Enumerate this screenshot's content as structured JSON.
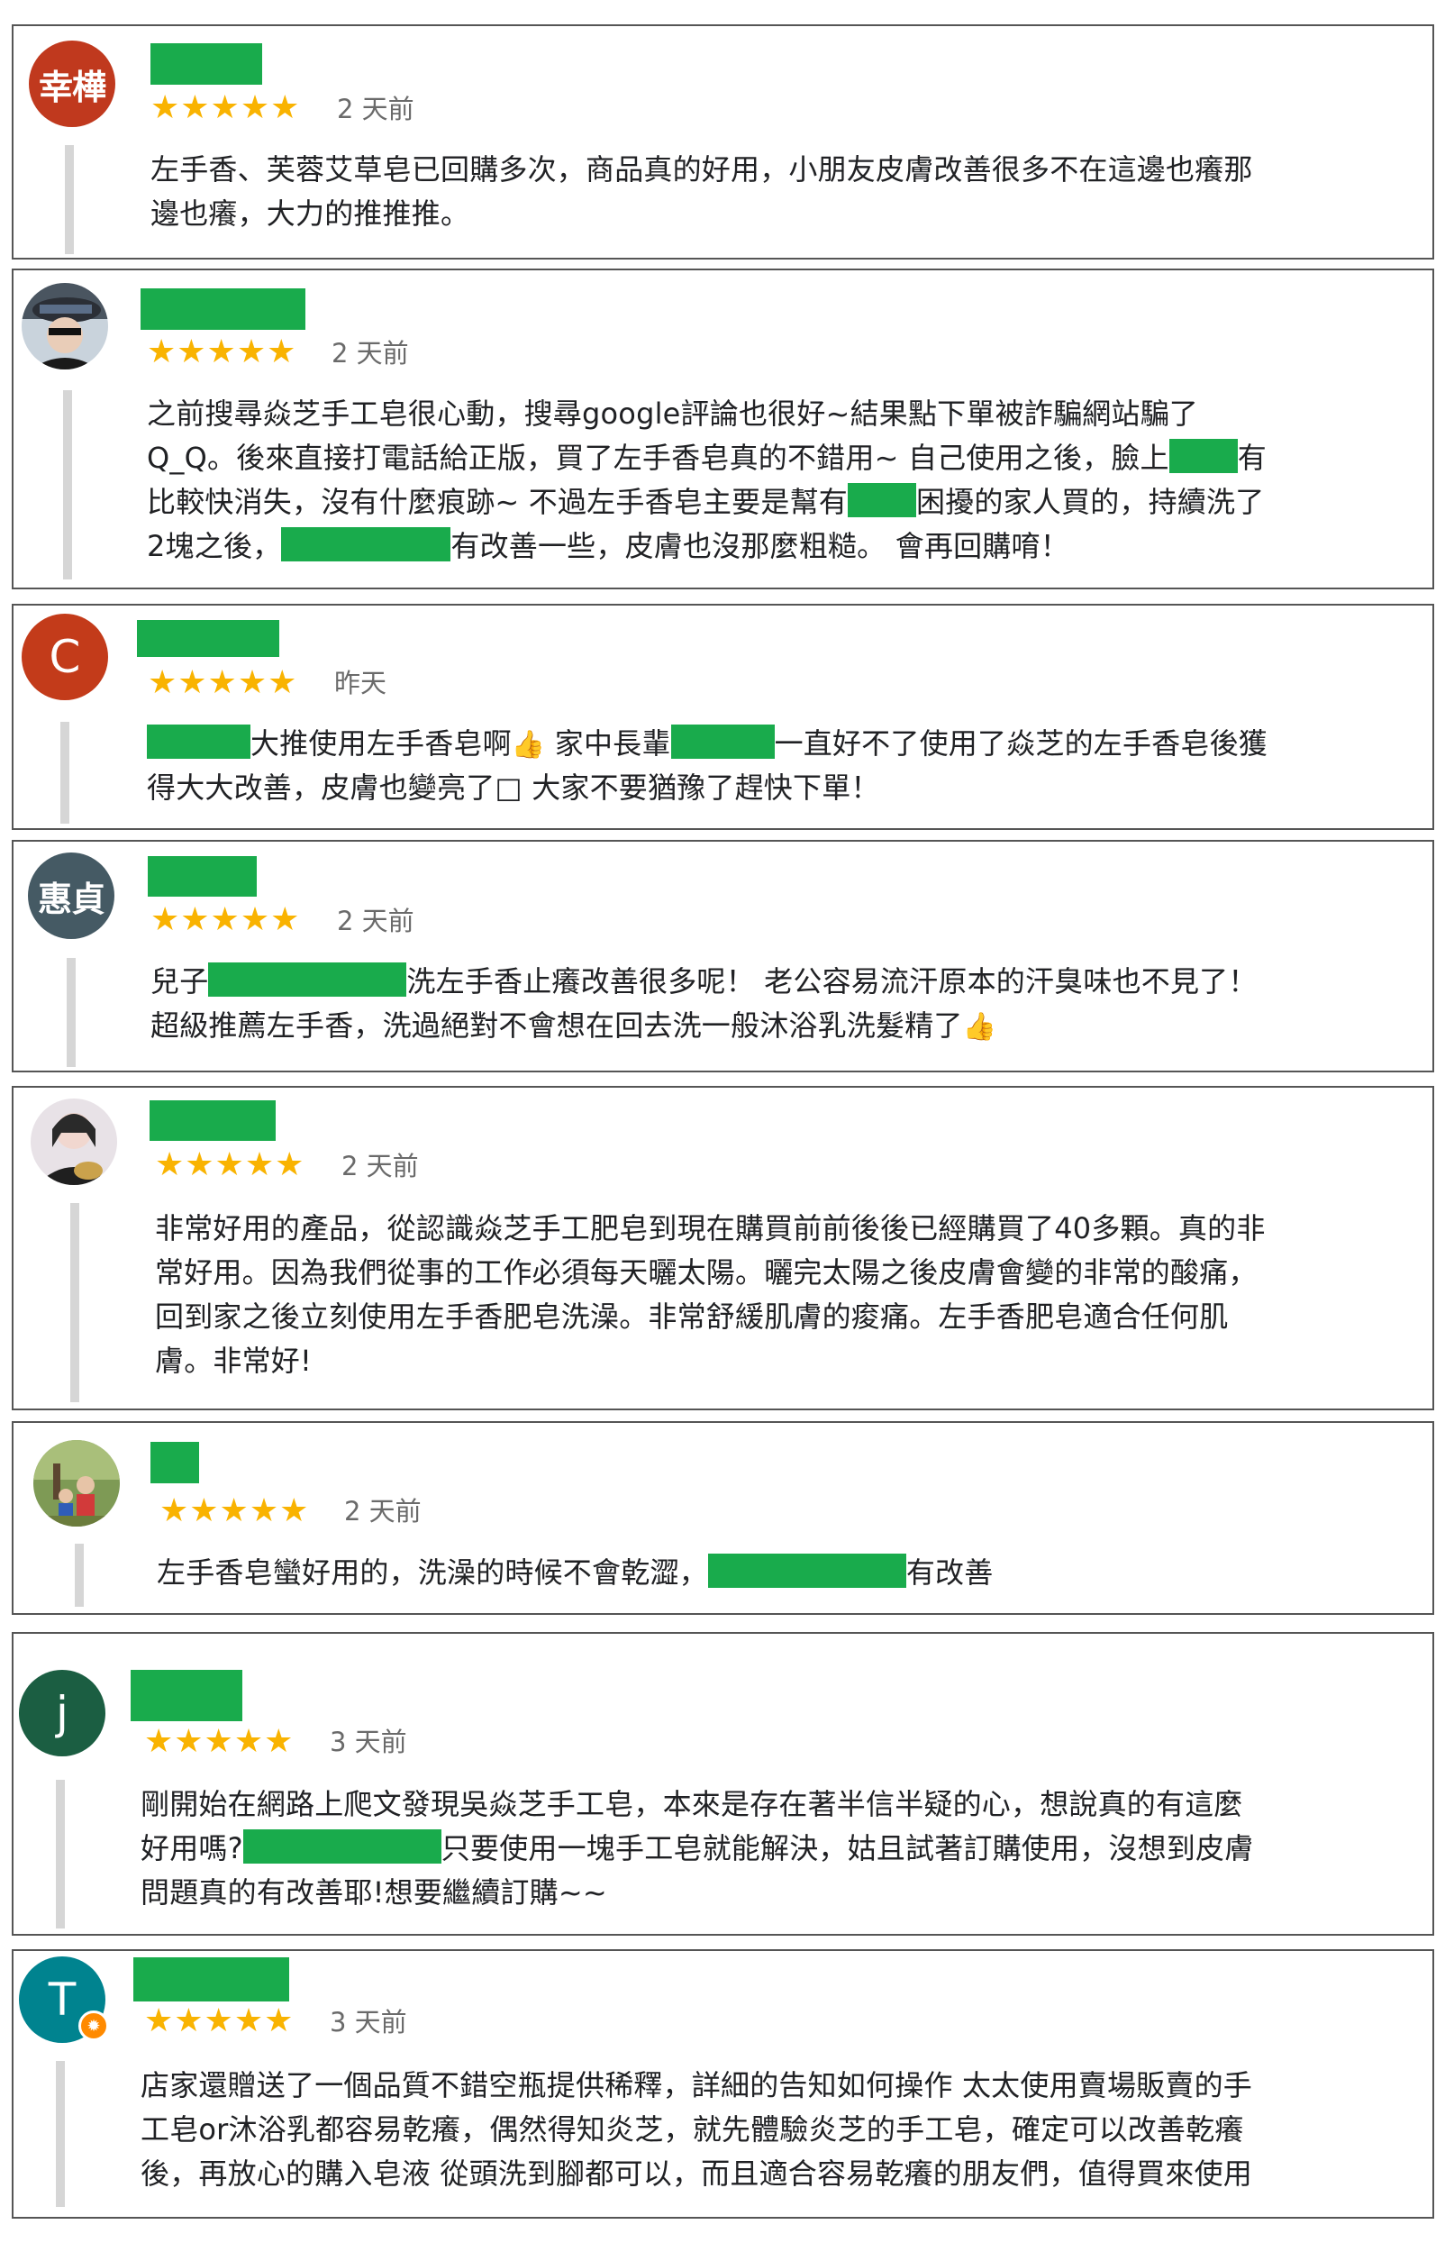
{
  "colors": {
    "star": "#f9b301",
    "redaction": "#19ab4c",
    "border": "#555555",
    "quote_bar": "#d6d6d6",
    "time_text": "#6a6a6a"
  },
  "reviews": [
    {
      "avatar": {
        "type": "text",
        "text": "幸樺",
        "bg": "#c0391e"
      },
      "stars": "★★★★★",
      "time": "2 天前",
      "lines": [
        [
          {
            "t": "左手香、芙蓉艾草皂已回購多次，商品真的好用，小朋友皮膚改善很多不在這邊也癢那"
          }
        ],
        [
          {
            "t": "邊也癢，大力的推推推。"
          }
        ]
      ]
    },
    {
      "avatar": {
        "type": "photo",
        "icon": "person-with-hat-icon"
      },
      "stars": "★★★★★",
      "time": "2 天前",
      "lines": [
        [
          {
            "t": "之前搜尋焱芝手工皂很心動，搜尋google評論也很好~結果點下單被詐騙網站騙了"
          }
        ],
        [
          {
            "t": "Q_Q。後來直接打電話給正版，買了左手香皂真的不錯用~ 自己使用之後，臉上"
          },
          {
            "r": 48
          },
          {
            "t": "有"
          }
        ],
        [
          {
            "t": "比較快消失，沒有什麼痕跡~ 不過左手香皂主要是幫有"
          },
          {
            "r": 48
          },
          {
            "t": "困擾的家人買的，持續洗了"
          }
        ],
        [
          {
            "t": "2塊之後，"
          },
          {
            "r": 118
          },
          {
            "t": "有改善一些，皮膚也沒那麼粗糙。 會再回購唷！"
          }
        ]
      ]
    },
    {
      "avatar": {
        "type": "letter",
        "text": "C",
        "bg": "#c33b1a"
      },
      "stars": "★★★★★",
      "time": "昨天",
      "lines": [
        [
          {
            "r": 72
          },
          {
            "t": "大推使用左手香皂啊"
          },
          {
            "e": "👍"
          },
          {
            "t": " 家中長輩"
          },
          {
            "r": 72
          },
          {
            "t": "一直好不了使用了焱芝的左手香皂後獲"
          }
        ],
        [
          {
            "t": "得大大改善，皮膚也變亮了□ 大家不要猶豫了趕快下單！"
          }
        ]
      ]
    },
    {
      "avatar": {
        "type": "text",
        "text": "惠貞",
        "bg": "#455a64"
      },
      "stars": "★★★★★",
      "time": "2 天前",
      "lines": [
        [
          {
            "t": "兒子"
          },
          {
            "r": 138
          },
          {
            "t": "洗左手香止癢改善很多呢！ 老公容易流汗原本的汗臭味也不見了！"
          }
        ],
        [
          {
            "t": "超級推薦左手香，洗過絕對不會想在回去洗一般沐浴乳洗髮精了"
          },
          {
            "e": "👍"
          }
        ]
      ]
    },
    {
      "avatar": {
        "type": "photo",
        "icon": "person-with-guitar-icon"
      },
      "stars": "★★★★★",
      "time": "2 天前",
      "lines": [
        [
          {
            "t": "非常好用的產品，從認識焱芝手工肥皂到現在購買前前後後已經購買了40多顆。真的非"
          }
        ],
        [
          {
            "t": "常好用。因為我們從事的工作必須每天曬太陽。曬完太陽之後皮膚會變的非常的酸痛，"
          }
        ],
        [
          {
            "t": "回到家之後立刻使用左手香肥皂洗澡。非常舒緩肌膚的痠痛。左手香肥皂適合任何肌"
          }
        ],
        [
          {
            "t": "膚。非常好!"
          }
        ]
      ]
    },
    {
      "avatar": {
        "type": "photo",
        "icon": "family-outdoor-icon"
      },
      "stars": "★★★★★",
      "time": "2 天前",
      "lines": [
        [
          {
            "t": "左手香皂蠻好用的，洗澡的時候不會乾澀，"
          },
          {
            "r": 138
          },
          {
            "t": "有改善"
          }
        ]
      ]
    },
    {
      "avatar": {
        "type": "letter",
        "text": "j",
        "bg": "#1b5e42"
      },
      "stars": "★★★★★",
      "time": "3 天前",
      "lines": [
        [
          {
            "t": "剛開始在網路上爬文發現吳焱芝手工皂，本來是存在著半信半疑的心，想說真的有這麼"
          }
        ],
        [
          {
            "t": "好用嗎?"
          },
          {
            "r": 138
          },
          {
            "t": "只要使用一塊手工皂就能解決，姑且試著訂購使用，沒想到皮膚"
          }
        ],
        [
          {
            "t": "問題真的有改善耶!想要繼續訂購~~"
          }
        ]
      ]
    },
    {
      "avatar": {
        "type": "letter",
        "text": "T",
        "bg": "#00838f",
        "badge": "local-guide-badge-icon"
      },
      "stars": "★★★★★",
      "time": "3 天前",
      "lines": [
        [
          {
            "t": "店家還贈送了一個品質不錯空瓶提供稀釋，詳細的告知如何操作 太太使用賣場販賣的手"
          }
        ],
        [
          {
            "t": "工皂or沐浴乳都容易乾癢，偶然得知炎芝，就先體驗炎芝的手工皂，確定可以改善乾癢"
          }
        ],
        [
          {
            "t": "後，再放心的購入皂液 從頭洗到腳都可以，而且適合容易乾癢的朋友們，值得買來使用"
          }
        ]
      ]
    }
  ]
}
